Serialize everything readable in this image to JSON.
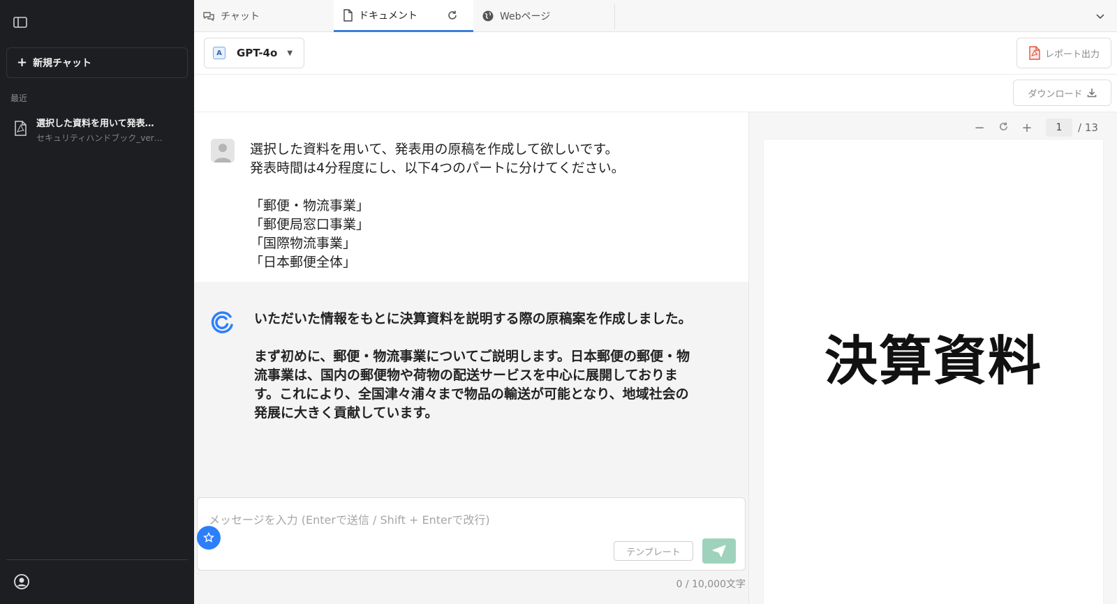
{
  "sidebar": {
    "new_chat_label": "新規チャット",
    "section_recent": "最近",
    "history": [
      {
        "title": "選択した資料を用いて発表…",
        "subtitle": "セキュリティハンドブック_ver…"
      }
    ]
  },
  "tabs": [
    {
      "label": "チャット",
      "icon": "chat-icon"
    },
    {
      "label": "ドキュメント",
      "icon": "document-icon"
    },
    {
      "label": "Webページ",
      "icon": "globe-icon"
    }
  ],
  "toolbar": {
    "model": "GPT-4o",
    "report_label": "レポート出力",
    "download_label": "ダウンロード"
  },
  "conversation": {
    "user_message": "選択した資料を用いて、発表用の原稿を作成して欲しいです。\n発表時間は4分程度にし、以下4つのパートに分けてください。\n\n「郵便・物流事業」\n「郵便局窓口事業」\n「国際物流事業」\n「日本郵便全体」",
    "ai_paragraph1": "いただいた情報をもとに決算資料を説明する際の原稿案を作成しました。",
    "ai_paragraph2": "まず初めに、郵便・物流事業についてご説明します。日本郵便の郵便・物流事業は、国内の郵便物や荷物の配送サービスを中心に展開しております。これにより、全国津々浦々まで物品の輸送が可能となり、地域社会の発展に大きく貢献しています。"
  },
  "input": {
    "placeholder": "メッセージを入力 (Enterで送信 / Shift + Enterで改行)",
    "template_label": "テンプレート",
    "char_count": "0 / 10,000文字"
  },
  "viewer": {
    "current_page": "1",
    "total_pages": "/ 13",
    "page_title": "決算資料"
  },
  "colors": {
    "sidebar_bg": "#1c1e21",
    "accent": "#3b7ddd",
    "send_button": "#9ed2bd"
  }
}
